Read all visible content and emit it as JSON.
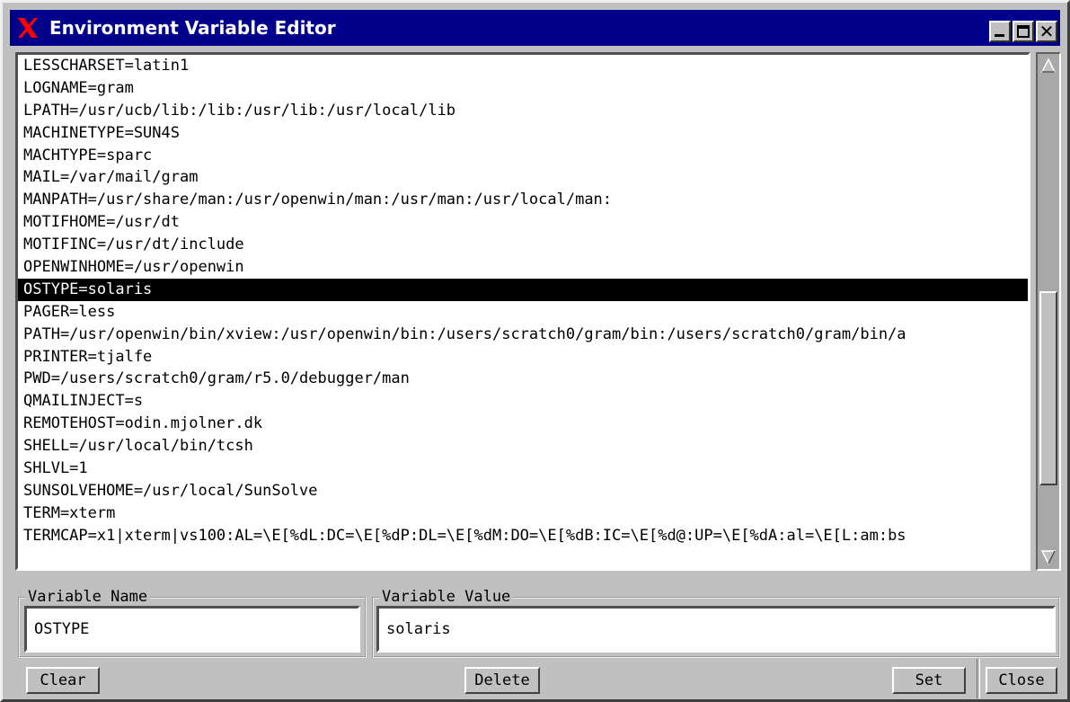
{
  "window": {
    "title": "Environment Variable Editor",
    "colors": {
      "titlebar": "#00008b",
      "background": "#c0c0c0",
      "selection": "#000000",
      "logo": "#ff0000"
    }
  },
  "env_list": {
    "selected_index": 10,
    "items": [
      "LESSCHARSET=latin1",
      "LOGNAME=gram",
      "LPATH=/usr/ucb/lib:/lib:/usr/lib:/usr/local/lib",
      "MACHINETYPE=SUN4S",
      "MACHTYPE=sparc",
      "MAIL=/var/mail/gram",
      "MANPATH=/usr/share/man:/usr/openwin/man:/usr/man:/usr/local/man:",
      "MOTIFHOME=/usr/dt",
      "MOTIFINC=/usr/dt/include",
      "OPENWINHOME=/usr/openwin",
      "OSTYPE=solaris",
      "PAGER=less",
      "PATH=/usr/openwin/bin/xview:/usr/openwin/bin:/users/scratch0/gram/bin:/users/scratch0/gram/bin/a",
      "PRINTER=tjalfe",
      "PWD=/users/scratch0/gram/r5.0/debugger/man",
      "QMAILINJECT=s",
      "REMOTEHOST=odin.mjolner.dk",
      "SHELL=/usr/local/bin/tcsh",
      "SHLVL=1",
      "SUNSOLVEHOME=/usr/local/SunSolve",
      "TERM=xterm",
      "TERMCAP=x1|xterm|vs100:AL=\\E[%dL:DC=\\E[%dP:DL=\\E[%dM:DO=\\E[%dB:IC=\\E[%d@:UP=\\E[%dA:al=\\E[L:am:bs"
    ]
  },
  "variable_name": {
    "label": "Variable Name",
    "value": "OSTYPE"
  },
  "variable_value": {
    "label": "Variable Value",
    "value": "solaris"
  },
  "buttons": {
    "clear": "Clear",
    "delete": "Delete",
    "set": "Set",
    "close": "Close"
  }
}
